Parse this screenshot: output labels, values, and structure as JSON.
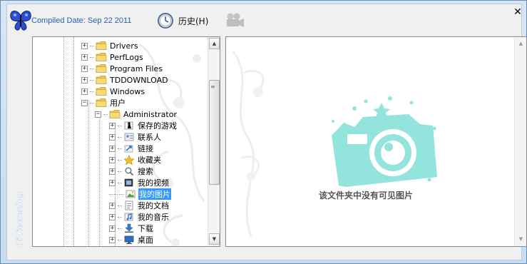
{
  "header": {
    "compiled_label": "Compiled Date: Sep 22 2011",
    "history_label": "历史(H)"
  },
  "brand_vertical": "DiViewer.log",
  "tree": {
    "items": [
      {
        "label": "Drivers",
        "level": 0,
        "expander": "+",
        "icon": "folder-icon"
      },
      {
        "label": "PerfLogs",
        "level": 0,
        "expander": "+",
        "icon": "folder-icon"
      },
      {
        "label": "Program Files",
        "level": 0,
        "expander": "+",
        "icon": "folder-icon"
      },
      {
        "label": "TDDOWNLOAD",
        "level": 0,
        "expander": "+",
        "icon": "folder-icon"
      },
      {
        "label": "Windows",
        "level": 0,
        "expander": "+",
        "icon": "folder-icon"
      },
      {
        "label": "用户",
        "level": 0,
        "expander": "−",
        "icon": "folder-icon"
      },
      {
        "label": "Administrator",
        "level": 1,
        "expander": "−",
        "icon": "folder-icon"
      },
      {
        "label": "保存的游戏",
        "level": 2,
        "expander": "+",
        "icon": "saved-games-icon"
      },
      {
        "label": "联系人",
        "level": 2,
        "expander": "+",
        "icon": "contacts-icon"
      },
      {
        "label": "链接",
        "level": 2,
        "expander": "+",
        "icon": "links-icon"
      },
      {
        "label": "收藏夹",
        "level": 2,
        "expander": "+",
        "icon": "favorites-icon"
      },
      {
        "label": "搜索",
        "level": 2,
        "expander": "+",
        "icon": "search-icon"
      },
      {
        "label": "我的视频",
        "level": 2,
        "expander": "+",
        "icon": "videos-icon"
      },
      {
        "label": "我的图片",
        "level": 2,
        "expander": "",
        "icon": "pictures-icon",
        "selected": true
      },
      {
        "label": "我的文档",
        "level": 2,
        "expander": "+",
        "icon": "documents-icon"
      },
      {
        "label": "我的音乐",
        "level": 2,
        "expander": "+",
        "icon": "music-icon"
      },
      {
        "label": "下载",
        "level": 2,
        "expander": "+",
        "icon": "downloads-icon"
      },
      {
        "label": "桌面",
        "level": 2,
        "expander": "+",
        "icon": "desktop-icon"
      }
    ]
  },
  "viewer": {
    "empty_message": "该文件夹中没有可见图片"
  },
  "colors": {
    "accent": "#2a5fa8",
    "selection": "#3399ff",
    "camera_watermark": "#6fd8cf"
  }
}
